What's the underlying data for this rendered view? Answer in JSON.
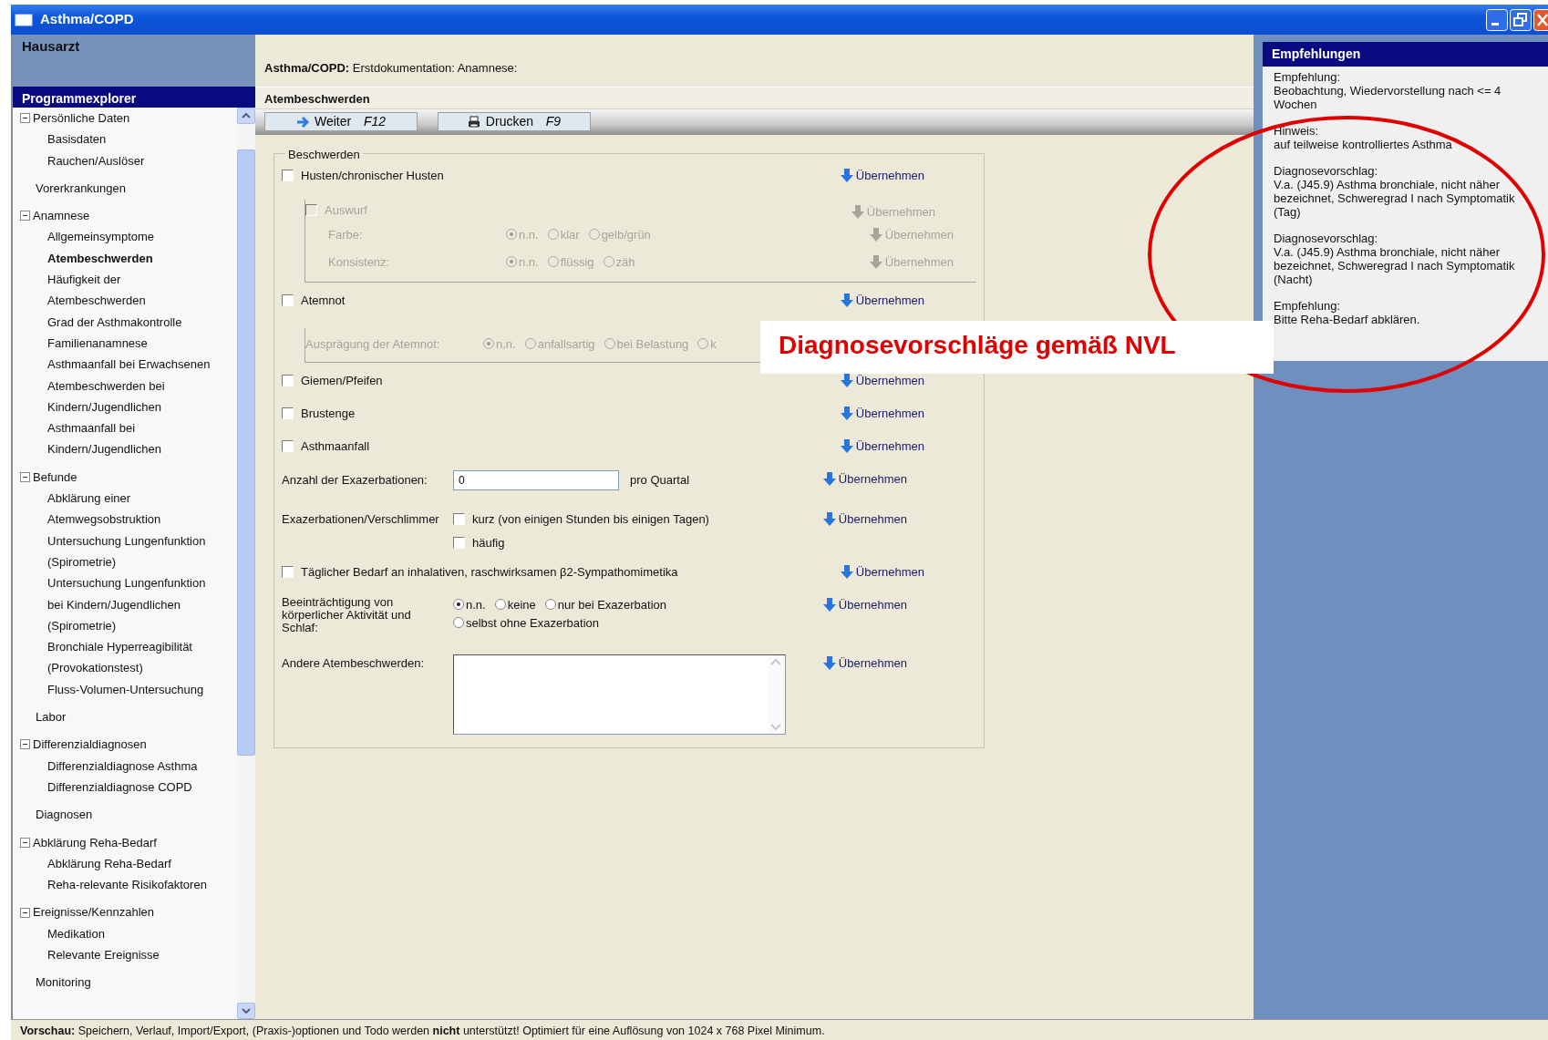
{
  "window": {
    "title": "Asthma/COPD"
  },
  "sidebar": {
    "header": "Hausarzt",
    "explorer_title": "Programmexplorer",
    "items": [
      {
        "label": "Persönliche Daten",
        "expanded": true,
        "selected": false,
        "children": [
          {
            "lines": [
              "Basisdaten"
            ],
            "selected": false
          },
          {
            "lines": [
              "Rauchen/Auslöser"
            ],
            "selected": false
          }
        ]
      },
      {
        "label": "Vorerkrankungen",
        "selected": false
      },
      {
        "label": "Anamnese",
        "expanded": true,
        "selected": false,
        "children": [
          {
            "lines": [
              "Allgemeinsymptome"
            ],
            "selected": false
          },
          {
            "lines": [
              "Atembeschwerden"
            ],
            "selected": true
          },
          {
            "lines": [
              "Häufigkeit der",
              "Atembeschwerden"
            ],
            "selected": false
          },
          {
            "lines": [
              "Grad der Asthmakontrolle"
            ],
            "selected": false
          },
          {
            "lines": [
              "Familienanamnese"
            ],
            "selected": false
          },
          {
            "lines": [
              "Asthmaanfall bei Erwachsenen"
            ],
            "selected": false
          },
          {
            "lines": [
              "Atembeschwerden bei",
              "Kindern/Jugendlichen"
            ],
            "selected": false
          },
          {
            "lines": [
              "Asthmaanfall bei",
              "Kindern/Jugendlichen"
            ],
            "selected": false
          }
        ]
      },
      {
        "label": "Befunde",
        "expanded": true,
        "selected": false,
        "children": [
          {
            "lines": [
              "Abklärung einer",
              "Atemwegsobstruktion"
            ],
            "selected": false
          },
          {
            "lines": [
              "Untersuchung Lungenfunktion",
              "(Spirometrie)"
            ],
            "selected": false
          },
          {
            "lines": [
              "Untersuchung Lungenfunktion",
              "bei Kindern/Jugendlichen",
              "(Spirometrie)"
            ],
            "selected": false
          },
          {
            "lines": [
              "Bronchiale Hyperreagibilität",
              "(Provokationstest)"
            ],
            "selected": false
          },
          {
            "lines": [
              "Fluss-Volumen-Untersuchung"
            ],
            "selected": false
          }
        ]
      },
      {
        "label": "Labor",
        "selected": false
      },
      {
        "label": "Differenzialdiagnosen",
        "expanded": true,
        "selected": false,
        "children": [
          {
            "lines": [
              "Differenzialdiagnose Asthma"
            ],
            "selected": false
          },
          {
            "lines": [
              "Differenzialdiagnose COPD"
            ],
            "selected": false
          }
        ]
      },
      {
        "label": "Diagnosen",
        "selected": false
      },
      {
        "label": "Abklärung Reha-Bedarf",
        "expanded": true,
        "selected": false,
        "children": [
          {
            "lines": [
              "Abklärung Reha-Bedarf"
            ],
            "selected": false
          },
          {
            "lines": [
              "Reha-relevante Risikofaktoren"
            ],
            "selected": false
          }
        ]
      },
      {
        "label": "Ereignisse/Kennzahlen",
        "expanded": true,
        "selected": false,
        "children": [
          {
            "lines": [
              "Medikation"
            ],
            "selected": false
          },
          {
            "lines": [
              "Relevante Ereignisse"
            ],
            "selected": false
          }
        ]
      },
      {
        "label": "Monitoring",
        "selected": false
      }
    ]
  },
  "main": {
    "breadcrumb": "**Asthma/COPD:** Erstdokumentation: Anamnese:",
    "page_title": "Atembeschwerden",
    "toolbar": [
      {
        "label": "Weiter",
        "key": "F12"
      },
      {
        "label": "Drucken",
        "key": "F9"
      }
    ],
    "form": {
      "legend": "Beschwerden",
      "rows": [
        {
          "kind": "check",
          "label": "Husten/chronischer Husten",
          "checked": false,
          "adopt": "Übernehmen"
        },
        {
          "kind": "subgroup",
          "disabled": true,
          "check": {
            "label": "Auswurf",
            "checked": false,
            "adopt": "Übernehmen"
          },
          "radios": [
            {
              "label": "Farbe:",
              "options": [
                {
                  "label": "n.n.",
                  "selected": true
                },
                {
                  "label": "klar",
                  "selected": false
                },
                {
                  "label": "gelb/grün",
                  "selected": false
                }
              ],
              "adopt": "Übernehmen"
            },
            {
              "label": "Konsistenz:",
              "options": [
                {
                  "label": "n.n.",
                  "selected": true
                },
                {
                  "label": "flüssig",
                  "selected": false
                },
                {
                  "label": "zäh",
                  "selected": false
                }
              ],
              "adopt": "Übernehmen"
            }
          ]
        },
        {
          "kind": "check",
          "label": "Atemnot",
          "checked": false,
          "adopt": "Übernehmen"
        },
        {
          "kind": "radiobox",
          "disabled": true,
          "label": "Ausprägung der Atemnot:",
          "options": [
            {
              "label": "n.n.",
              "selected": true
            },
            {
              "label": "anfallsartig",
              "selected": false
            },
            {
              "label": "bei Belastung",
              "selected": false
            },
            {
              "label": "k",
              "selected": false
            }
          ]
        },
        {
          "kind": "check",
          "label": "Giemen/Pfeifen",
          "checked": false,
          "adopt": "Übernehmen"
        },
        {
          "kind": "check",
          "label": "Brustenge",
          "checked": false,
          "adopt": "Übernehmen"
        },
        {
          "kind": "check",
          "label": "Asthmaanfall",
          "checked": false,
          "adopt": "Übernehmen"
        },
        {
          "kind": "number",
          "label": "Anzahl der Exazerbationen:",
          "value": "0",
          "unit": "pro Quartal",
          "adopt": "Übernehmen"
        },
        {
          "kind": "checklist",
          "label": "Exazerbationen/Verschlimmer",
          "options": [
            {
              "label": "kurz (von einigen Stunden bis einigen Tagen)",
              "checked": false
            },
            {
              "label": "häufig",
              "checked": false
            }
          ],
          "adopt": "Übernehmen"
        },
        {
          "kind": "check",
          "label": "Täglicher Bedarf an inhalativen, raschwirksamen β2-Sympathomimetika",
          "checked": false,
          "adopt": "Übernehmen"
        },
        {
          "kind": "radios",
          "label": "Beeinträchtigung von körperlicher Aktivität und Schlaf:",
          "options": [
            {
              "label": "n.n.",
              "selected": true
            },
            {
              "label": "keine",
              "selected": false
            },
            {
              "label": "nur bei Exazerbation",
              "selected": false
            },
            {
              "label": "selbst ohne Exazerbation",
              "selected": false
            }
          ],
          "adopt": "Übernehmen"
        },
        {
          "kind": "textarea",
          "label": "Andere Atembeschwerden:",
          "adopt": "Übernehmen"
        }
      ]
    }
  },
  "recommendations": {
    "title": "Empfehlungen",
    "entries": [
      {
        "heading": "Empfehlung:",
        "text": "Beobachtung, Wiedervorstellung nach <= 4 Wochen"
      },
      {
        "heading": "Hinweis:",
        "text": "auf teilweise kontrolliertes Asthma"
      },
      {
        "heading": "Diagnosevorschlag:",
        "text": "V.a. (J45.9) Asthma bronchiale, nicht näher bezeichnet, Schweregrad I nach Symptomatik (Tag)"
      },
      {
        "heading": "Diagnosevorschlag:",
        "text": "V.a. (J45.9) Asthma bronchiale, nicht näher bezeichnet, Schweregrad I nach Symptomatik (Nacht)"
      },
      {
        "heading": "Empfehlung:",
        "text": "Bitte Reha-Bedarf abklären."
      }
    ]
  },
  "annotation": {
    "callout": "Diagnosevorschläge gemäß NVL"
  },
  "status_bar": "**Vorschau:** Speichern, Verlauf, Import/Export, (Praxis-)optionen und Todo werden **nicht** unterstützt! Optimiert für eine Auflösung von 1024 x 768 Pixel Minimum."
}
